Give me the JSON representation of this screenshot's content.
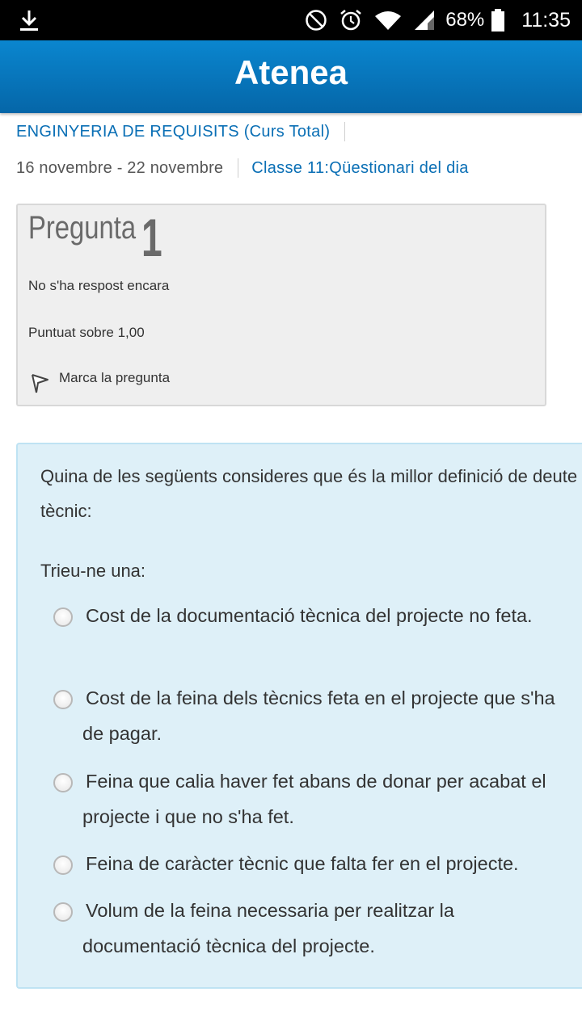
{
  "status_bar": {
    "battery_percent": "68%",
    "time": "11:35",
    "icons": [
      "download-icon",
      "do-not-disturb-icon",
      "alarm-icon",
      "wifi-icon",
      "signal-icon",
      "battery-icon"
    ]
  },
  "app": {
    "title": "Atenea"
  },
  "breadcrumb": {
    "course": "ENGINYERIA DE REQUISITS (Curs Total)",
    "week": "16 novembre - 22 novembre",
    "activity": "Classe 11:Qüestionari del dia"
  },
  "question_info": {
    "label": "Pregunta",
    "number": "1",
    "state": "No s'ha respost encara",
    "grade": "Puntuat sobre 1,00",
    "flag_label": "Marca la pregunta"
  },
  "question": {
    "text": "Quina de les següents consideres que és la millor definició de deute tècnic:",
    "prompt": "Trieu-ne una:",
    "answers": [
      "Cost de la documentació tècnica del projecte no feta.",
      "Cost de la feina dels tècnics feta en el projecte que s'ha de pagar.",
      "Feina que calia haver fet abans de donar per acabat el projecte i que no s'ha fet.",
      "Feina de caràcter tècnic que falta fer en el projecte.",
      "Volum de la feina necessaria per realitzar la documentació tècnica del projecte."
    ]
  },
  "colors": {
    "header": "#0a7cc4",
    "link": "#0a6fb5",
    "content_bg": "#def0f8",
    "info_bg": "#efefef"
  }
}
